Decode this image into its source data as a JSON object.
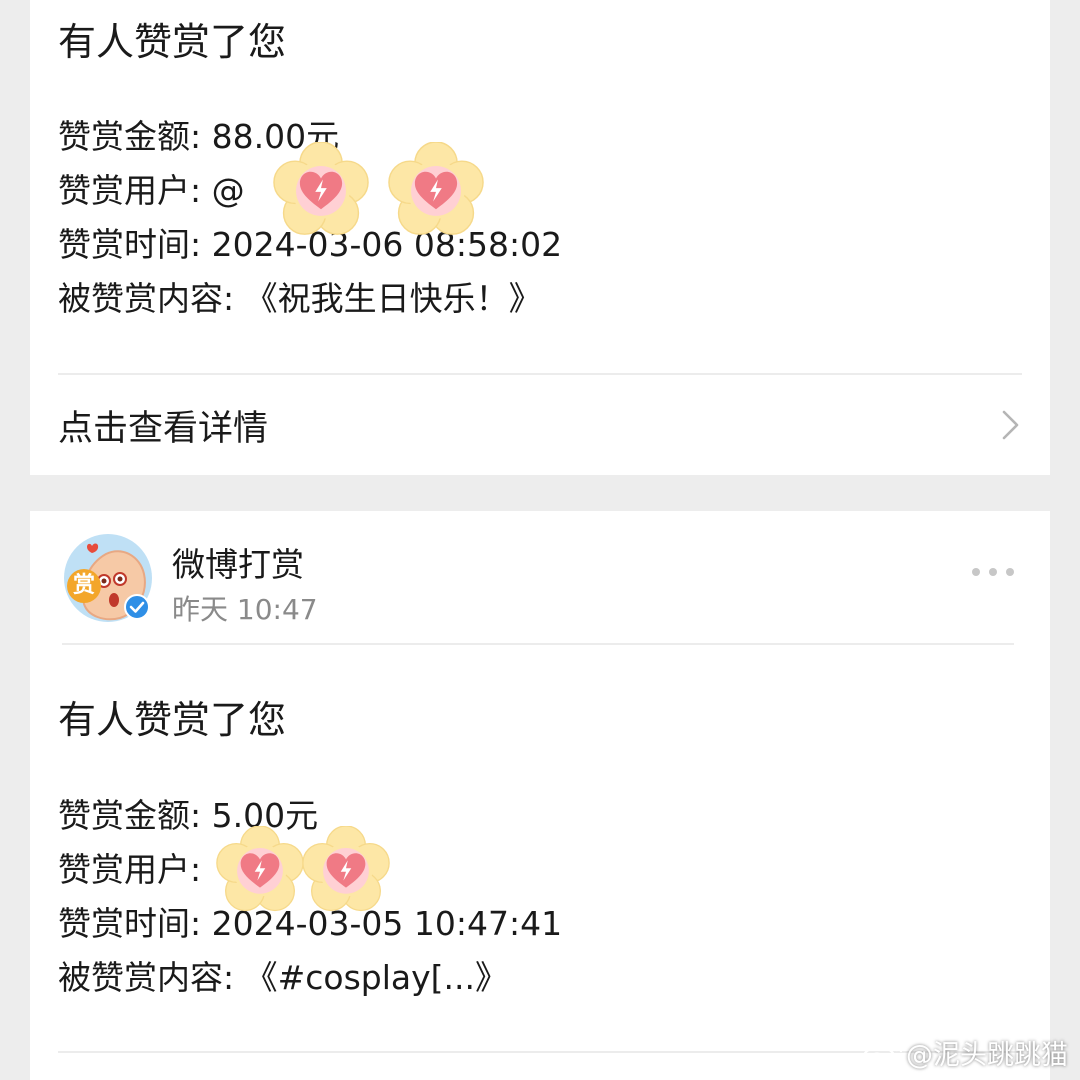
{
  "cards": [
    {
      "title": "有人赞赏了您",
      "rows": [
        {
          "label": "赞赏金额: ",
          "value": "88.00元"
        },
        {
          "label": "赞赏用户: ",
          "value": "@"
        },
        {
          "label": "赞赏时间: ",
          "value": "2024-03-06 08:58:02"
        },
        {
          "label": "被赞赏内容: ",
          "value": "《祝我生日快乐！》"
        }
      ],
      "detail_link": "点击查看详情"
    },
    {
      "account": {
        "name": "微博打赏",
        "time": "昨天 10:47",
        "avatar_badge": "赏"
      },
      "title": "有人赞赏了您",
      "rows": [
        {
          "label": "赞赏金额: ",
          "value": "5.00元"
        },
        {
          "label": "赞赏用户: ",
          "value": ""
        },
        {
          "label": "赞赏时间: ",
          "value": "2024-03-05 10:47:41"
        },
        {
          "label": "被赞赏内容: ",
          "value": "《#cosplay[...》"
        }
      ]
    }
  ],
  "watermark": "@泥头跳跳猫",
  "colors": {
    "background": "#ededed",
    "card": "#ffffff",
    "sticker_flower": "#fde7a6",
    "sticker_heart": "#f07a85",
    "verified": "#2f8fe6"
  },
  "icons": {
    "chevron": "chevron-right-icon",
    "sticker": "heart-flower-sticker",
    "more": "more-dots-icon"
  }
}
